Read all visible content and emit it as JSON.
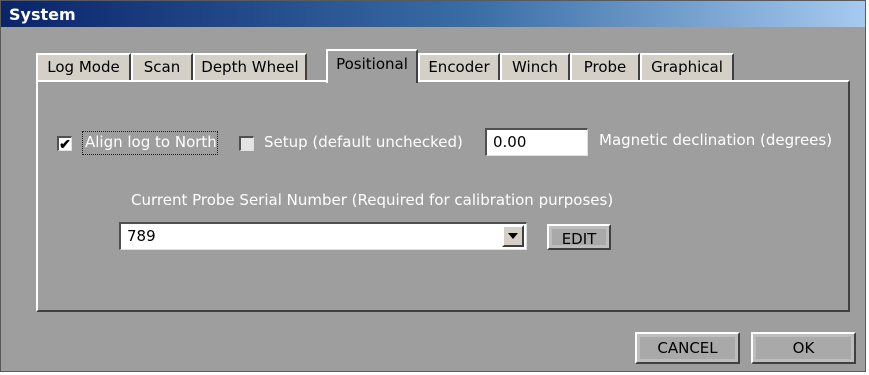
{
  "window": {
    "title": "System"
  },
  "tabs": [
    {
      "label": "Log Mode"
    },
    {
      "label": "Scan"
    },
    {
      "label": "Depth Wheel"
    },
    {
      "label": "Positional",
      "active": true
    },
    {
      "label": "Encoder"
    },
    {
      "label": "Winch"
    },
    {
      "label": "Probe"
    },
    {
      "label": "Graphical"
    }
  ],
  "positional": {
    "align_north": {
      "label": "Align log to North",
      "checked": true
    },
    "setup": {
      "label": "Setup (default unchecked)",
      "checked": false
    },
    "declination": {
      "value": "0.00",
      "label": "Magnetic declination (degrees)"
    },
    "probe_serial": {
      "label": "Current Probe Serial Number  (Required for calibration purposes)",
      "value": "789"
    },
    "edit_label": "EDIT"
  },
  "footer": {
    "cancel_label": "CANCEL",
    "ok_label": "OK"
  }
}
